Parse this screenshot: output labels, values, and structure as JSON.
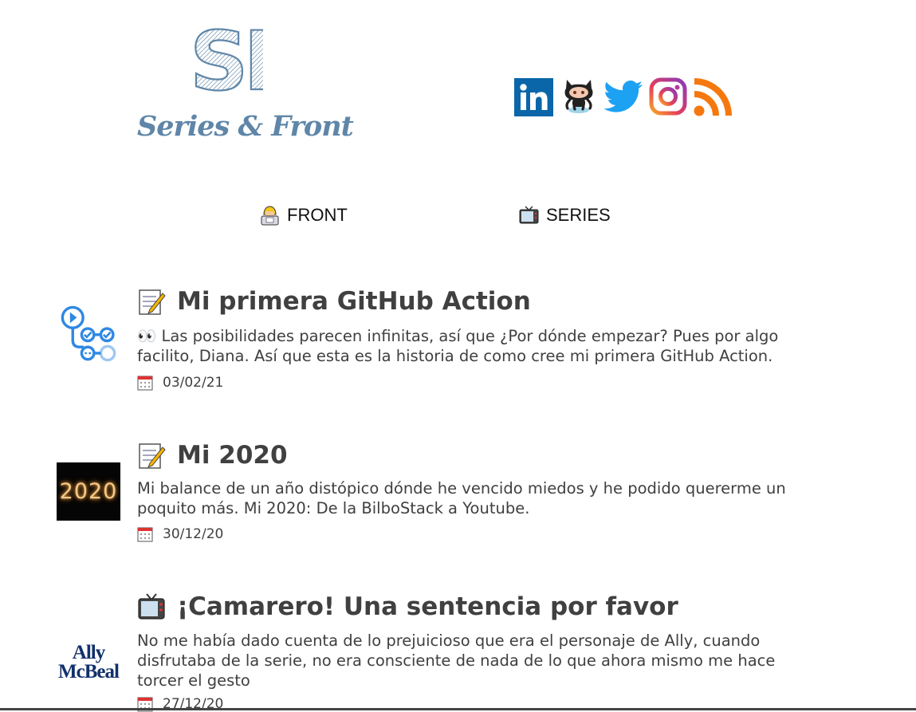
{
  "header": {
    "logo_initials": "SF",
    "logo_text": "Series & Front"
  },
  "social": [
    {
      "name": "linkedin-icon"
    },
    {
      "name": "github-icon"
    },
    {
      "name": "twitter-icon"
    },
    {
      "name": "instagram-icon"
    },
    {
      "name": "rss-icon"
    }
  ],
  "nav": {
    "front_label": "FRONT",
    "series_label": "SERIES"
  },
  "posts": [
    {
      "title": "Mi primera GitHub Action",
      "excerpt": "👀 Las posibilidades parecen infinitas, así que ¿Por dónde empezar? Pues por algo facilito, Diana. Así que esta es la historia de como cree mi primera GitHub Action.",
      "date": "03/02/21",
      "icon": "memo-icon",
      "thumb": "github-actions-logo"
    },
    {
      "title": "Mi 2020",
      "excerpt": "Mi balance de un año distópico dónde he vencido miedos y he podido quererme un poquito más. Mi 2020: De la BilboStack a Youtube.",
      "date": "30/12/20",
      "icon": "memo-icon",
      "thumb_text": "2020"
    },
    {
      "title": "¡Camarero! Una sentencia por favor",
      "excerpt": "No me había dado cuenta de lo prejuicioso que era el personaje de Ally, cuando disfrutaba de la serie, no era consciente de nada de lo que ahora mismo me hace torcer el gesto",
      "date": "27/12/20",
      "icon": "tv-icon",
      "thumb_text_1": "Ally",
      "thumb_text_2": "McBeal"
    }
  ]
}
